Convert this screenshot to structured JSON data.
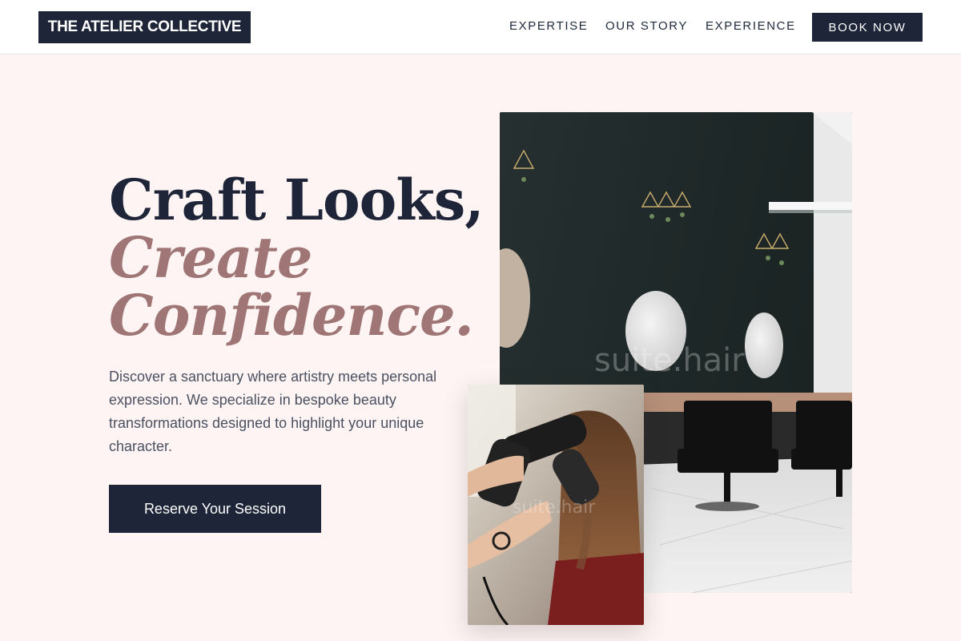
{
  "header": {
    "brand": "THE ATELIER COLLECTIVE",
    "nav": [
      "EXPERTISE",
      "OUR STORY",
      "EXPERIENCE"
    ],
    "cta": "BOOK NOW"
  },
  "hero": {
    "headline_line1": "Craft Looks,",
    "headline_accent_line1": "Create",
    "headline_accent_line2": "Confidence.",
    "description": "Discover a sanctuary where artistry meets personal expression. We specialize in bespoke beauty transformations designed to highlight your unique character.",
    "cta": "Reserve Your Session"
  },
  "images": {
    "main_watermark": "suite.hair",
    "small_watermark": "suite.hair"
  },
  "colors": {
    "page_background": "#fdf4f3",
    "navy": "#1e2538",
    "accent_rose": "#9f7575",
    "body_text": "#4b5161"
  },
  "icons": []
}
